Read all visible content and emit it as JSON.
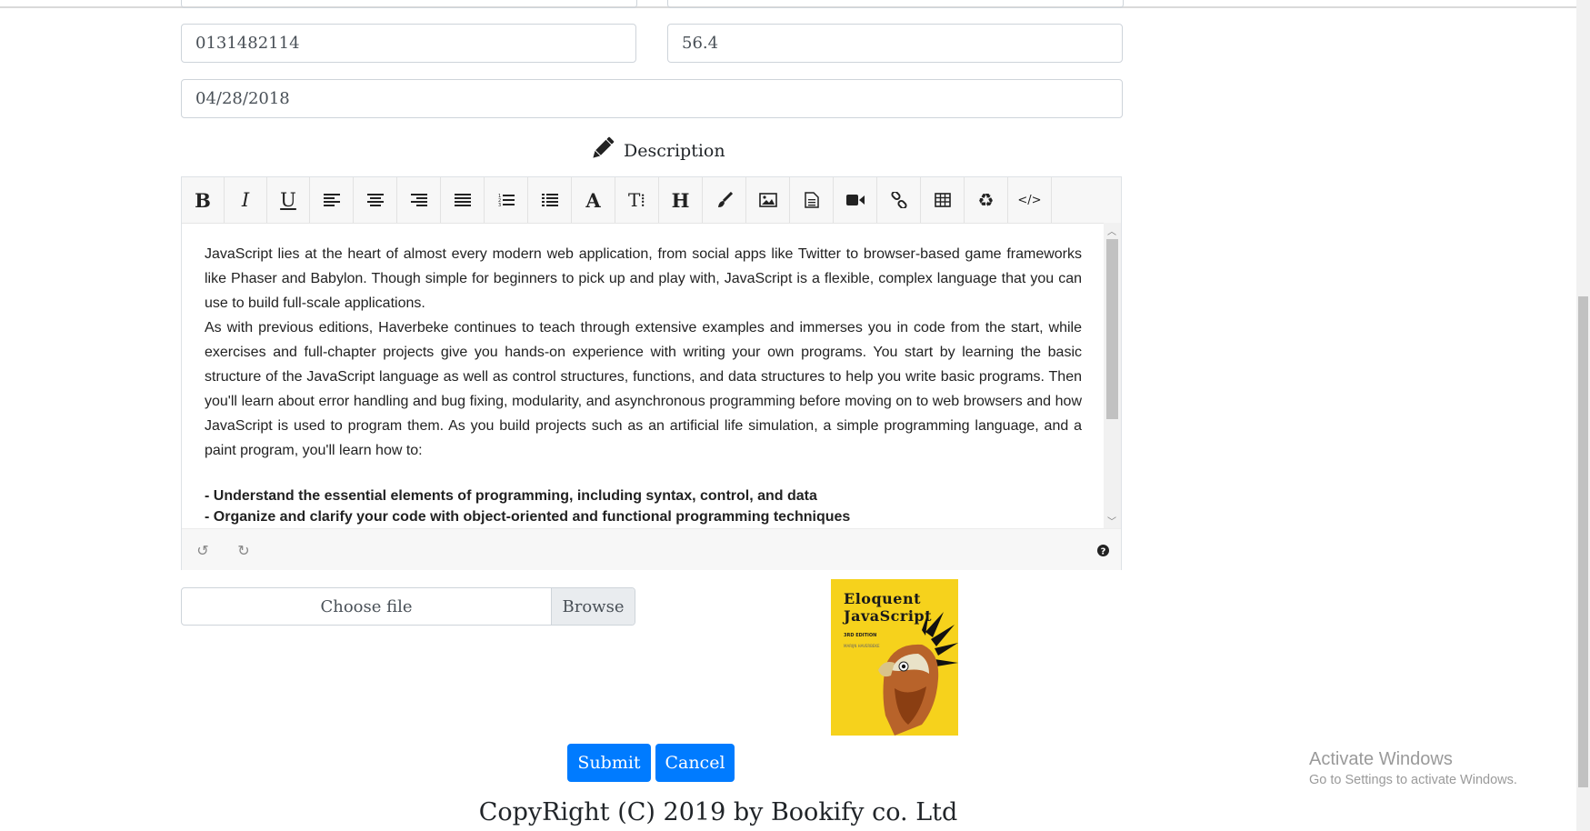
{
  "form": {
    "isbn_value": "0131482114",
    "price_value": "56.4",
    "date_value": "04/28/2018",
    "description_heading": "Description"
  },
  "editor": {
    "toolbar": [
      {
        "name": "bold-button",
        "icon": "bold-icon",
        "glyph": "B"
      },
      {
        "name": "italic-button",
        "icon": "italic-icon",
        "glyph": "I"
      },
      {
        "name": "underline-button",
        "icon": "underline-icon",
        "glyph": "U"
      },
      {
        "name": "align-left-button",
        "icon": "align-left-icon",
        "glyph": ""
      },
      {
        "name": "align-center-button",
        "icon": "align-center-icon",
        "glyph": ""
      },
      {
        "name": "align-right-button",
        "icon": "align-right-icon",
        "glyph": ""
      },
      {
        "name": "justify-button",
        "icon": "justify-icon",
        "glyph": ""
      },
      {
        "name": "ordered-list-button",
        "icon": "ordered-list-icon",
        "glyph": ""
      },
      {
        "name": "unordered-list-button",
        "icon": "unordered-list-icon",
        "glyph": ""
      },
      {
        "name": "font-color-button",
        "icon": "font-icon",
        "glyph": "A"
      },
      {
        "name": "font-size-button",
        "icon": "text-height-icon",
        "glyph": "T⇕"
      },
      {
        "name": "heading-button",
        "icon": "heading-icon",
        "glyph": "H"
      },
      {
        "name": "paint-brush-button",
        "icon": "paint-brush-icon",
        "glyph": ""
      },
      {
        "name": "insert-image-button",
        "icon": "image-icon",
        "glyph": ""
      },
      {
        "name": "insert-file-button",
        "icon": "file-icon",
        "glyph": ""
      },
      {
        "name": "insert-video-button",
        "icon": "video-icon",
        "glyph": ""
      },
      {
        "name": "insert-link-button",
        "icon": "link-icon",
        "glyph": ""
      },
      {
        "name": "insert-table-button",
        "icon": "table-icon",
        "glyph": ""
      },
      {
        "name": "remove-format-button",
        "icon": "recycle-icon",
        "glyph": ""
      },
      {
        "name": "code-view-button",
        "icon": "code-icon",
        "glyph": "</>"
      }
    ],
    "paragraph1": "JavaScript lies at the heart of almost every modern web application, from social apps like Twitter to browser-based game frameworks like Phaser and Babylon. Though simple for beginners to pick up and play with, JavaScript is a flexible, complex language that you can use to build full-scale applications.",
    "paragraph2": "As with previous editions, Haverbeke continues to teach through extensive examples and immerses you in code from the start, while exercises and full-chapter projects give you hands-on experience with writing your own programs. You start by learning the basic structure of the JavaScript language as well as control structures, functions, and data structures to help you write basic programs. Then you'll learn about error handling and bug fixing, modularity, and asynchronous programming before moving on to web browsers and how JavaScript is used to program them. As you build projects such as an artificial life simulation, a simple programming language, and a paint program, you'll learn how to:",
    "bullet1": "- Understand the essential elements of programming, including syntax, control, and data",
    "bullet2": "- Organize and clarify your code with object-oriented and functional programming techniques",
    "undo_icon": "undo-icon",
    "redo_icon": "redo-icon",
    "help_icon": "question-circle-icon"
  },
  "file_upload": {
    "label": "Choose file",
    "browse": "Browse"
  },
  "cover": {
    "title_line1": "Eloquent",
    "title_line2": "JavaScript",
    "edition": "3RD EDITION",
    "author": "MARIJN HAVERBEKE"
  },
  "actions": {
    "submit": "Submit",
    "cancel": "Cancel"
  },
  "footer": {
    "copyright": "CopyRight (C) 2019 by Bookify co. Ltd"
  },
  "watermark": {
    "line1": "Activate Windows",
    "line2": "Go to Settings to activate Windows."
  },
  "colors": {
    "primary": "#007bff",
    "cover_yellow": "#f6d21c"
  }
}
